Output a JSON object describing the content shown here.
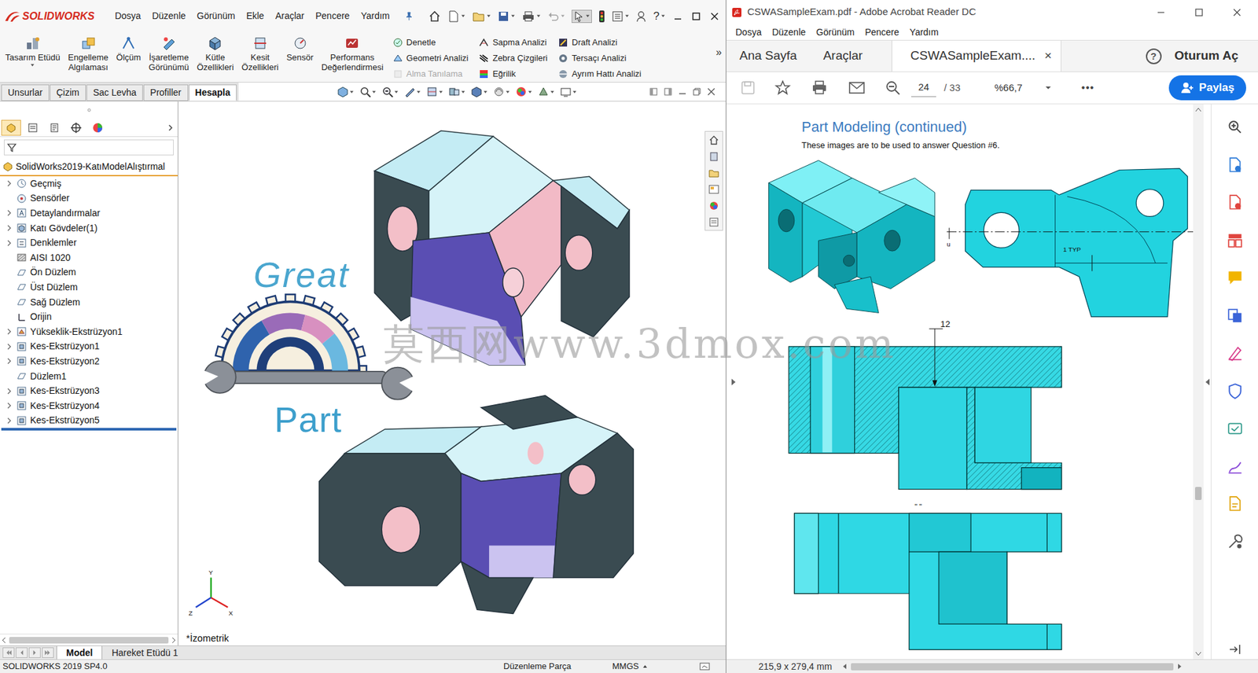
{
  "watermark": "莫西网www.3dmox.com",
  "solidworks": {
    "logo": "SOLIDWORKS",
    "menu": [
      "Dosya",
      "Düzenle",
      "Görünüm",
      "Ekle",
      "Araçlar",
      "Pencere",
      "Yardım"
    ],
    "help": "?",
    "ribbon_large": [
      {
        "lines": [
          "Tasarım Etüdü"
        ]
      },
      {
        "lines": [
          "Engelleme",
          "Algılaması"
        ]
      },
      {
        "lines": [
          "Ölçüm"
        ]
      },
      {
        "lines": [
          "İşaretleme",
          "Görünümü"
        ]
      },
      {
        "lines": [
          "Kütle",
          "Özellikleri"
        ]
      },
      {
        "lines": [
          "Kesit",
          "Özellikleri"
        ]
      },
      {
        "lines": [
          "Sensör"
        ]
      },
      {
        "lines": [
          "Performans",
          "Değerlendirmesi"
        ]
      }
    ],
    "ribbon_small": [
      [
        {
          "label": "Denetle",
          "disabled": false
        },
        {
          "label": "Geometri Analizi",
          "disabled": false
        },
        {
          "label": "Alma Tanılama",
          "disabled": true
        }
      ],
      [
        {
          "label": "Sapma Analizi",
          "disabled": false
        },
        {
          "label": "Zebra Çizgileri",
          "disabled": false
        },
        {
          "label": "Eğrilik",
          "disabled": false
        }
      ],
      [
        {
          "label": "Draft Analizi",
          "disabled": false
        },
        {
          "label": "Tersaçı Analizi",
          "disabled": false
        },
        {
          "label": "Ayrım Hattı Analizi",
          "disabled": false
        }
      ]
    ],
    "ribbon_more": "»",
    "tabs": [
      {
        "label": "Unsurlar",
        "selected": false
      },
      {
        "label": "Çizim",
        "selected": false
      },
      {
        "label": "Sac Levha",
        "selected": false
      },
      {
        "label": "Profiller",
        "selected": false
      },
      {
        "label": "Hesapla",
        "selected": true
      }
    ],
    "tree": {
      "root": "SolidWorks2019-KatıModelAlıştırmal",
      "items": [
        {
          "label": "Geçmiş",
          "expandable": true,
          "kind": "history"
        },
        {
          "label": "Sensörler",
          "expandable": false,
          "kind": "sensors"
        },
        {
          "label": "Detaylandırmalar",
          "expandable": true,
          "kind": "annotations"
        },
        {
          "label": "Katı Gövdeler(1)",
          "expandable": true,
          "kind": "bodies"
        },
        {
          "label": "Denklemler",
          "expandable": true,
          "kind": "equations"
        },
        {
          "label": "AISI 1020",
          "expandable": false,
          "kind": "material"
        },
        {
          "label": "Ön Düzlem",
          "expandable": false,
          "kind": "plane"
        },
        {
          "label": "Üst Düzlem",
          "expandable": false,
          "kind": "plane"
        },
        {
          "label": "Sağ Düzlem",
          "expandable": false,
          "kind": "plane"
        },
        {
          "label": "Orijin",
          "expandable": false,
          "kind": "origin"
        },
        {
          "label": "Yükseklik-Ekstrüzyon1",
          "expandable": true,
          "kind": "boss"
        },
        {
          "label": "Kes-Ekstrüzyon1",
          "expandable": true,
          "kind": "cut"
        },
        {
          "label": "Kes-Ekstrüzyon2",
          "expandable": true,
          "kind": "cut"
        },
        {
          "label": "Düzlem1",
          "expandable": false,
          "kind": "plane"
        },
        {
          "label": "Kes-Ekstrüzyon3",
          "expandable": true,
          "kind": "cut"
        },
        {
          "label": "Kes-Ekstrüzyon4",
          "expandable": true,
          "kind": "cut"
        },
        {
          "label": "Kes-Ekstrüzyon5",
          "expandable": true,
          "kind": "cut"
        }
      ]
    },
    "viewport": {
      "title_top": "Great",
      "title_bottom": "Part",
      "view_name": "*İzometrik",
      "axes": [
        "Y",
        "Z",
        "X"
      ]
    },
    "bottom_tabs": [
      {
        "label": "Model",
        "selected": true
      },
      {
        "label": "Hareket Etüdü 1",
        "selected": false
      }
    ],
    "status": {
      "version": "SOLIDWORKS 2019 SP4.0",
      "mode": "Düzenleme Parça",
      "units": "MMGS"
    }
  },
  "acrobat": {
    "title": "CSWASampleExam.pdf - Adobe Acrobat Reader DC",
    "menu": [
      "Dosya",
      "Düzenle",
      "Görünüm",
      "Pencere",
      "Yardım"
    ],
    "tabs": [
      {
        "label": "Ana Sayfa",
        "selected": false
      },
      {
        "label": "Araçlar",
        "selected": false
      },
      {
        "label": "CSWASampleExam....",
        "selected": true
      }
    ],
    "tab_close": "×",
    "help": "?",
    "sign_in": "Oturum Aç",
    "page": "24",
    "page_total": "/ 33",
    "zoom": "%66,7",
    "more": "•••",
    "share": "Paylaş",
    "document": {
      "heading": "Part Modeling (continued)",
      "subtitle": "These images are to be used to answer Question #6.",
      "axis_label": "u",
      "typ_label": "1 TYP",
      "dimension": "12",
      "view_label": "\" \""
    },
    "page_size": "215,9 x 279,4 mm"
  }
}
